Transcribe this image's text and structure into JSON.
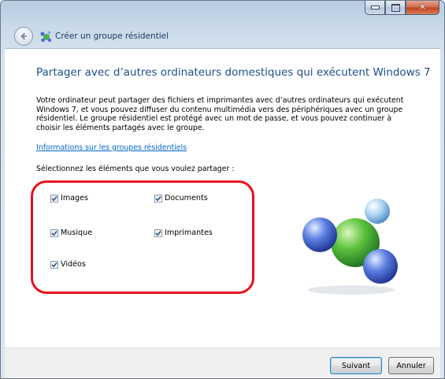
{
  "window": {
    "caption_buttons": [
      "minimize",
      "maximize",
      "close"
    ]
  },
  "header": {
    "title": "Créer un groupe résidentiel",
    "icon": "homegroup-icon"
  },
  "main": {
    "heading": "Partager avec d’autres ordinateurs domestiques qui exécutent Windows 7",
    "description": [
      "Votre ordinateur peut partager des fichiers et imprimantes avec d’autres ordinateurs qui exécutent",
      "Windows 7, et vous pouvez diffuser du contenu multimédia vers des périphériques avec un groupe",
      "résidentiel. Le groupe résidentiel est protégé avec un mot de passe, et vous pouvez continuer à",
      "choisir les éléments partagés avec le groupe."
    ],
    "info_link": "Informations sur les groupes résidentiels",
    "select_label": "Sélectionnez les éléments que vous voulez partager :",
    "items": [
      {
        "label": "Images",
        "checked": true
      },
      {
        "label": "Documents",
        "checked": true
      },
      {
        "label": "Musique",
        "checked": true
      },
      {
        "label": "Imprimantes",
        "checked": true
      },
      {
        "label": "Vidéos",
        "checked": true
      }
    ],
    "highlight_color": "#e8101c"
  },
  "footer": {
    "next_label": "Suivant",
    "cancel_label": "Annuler"
  },
  "colors": {
    "heading": "#1e4e8c",
    "link": "#0066cc"
  }
}
